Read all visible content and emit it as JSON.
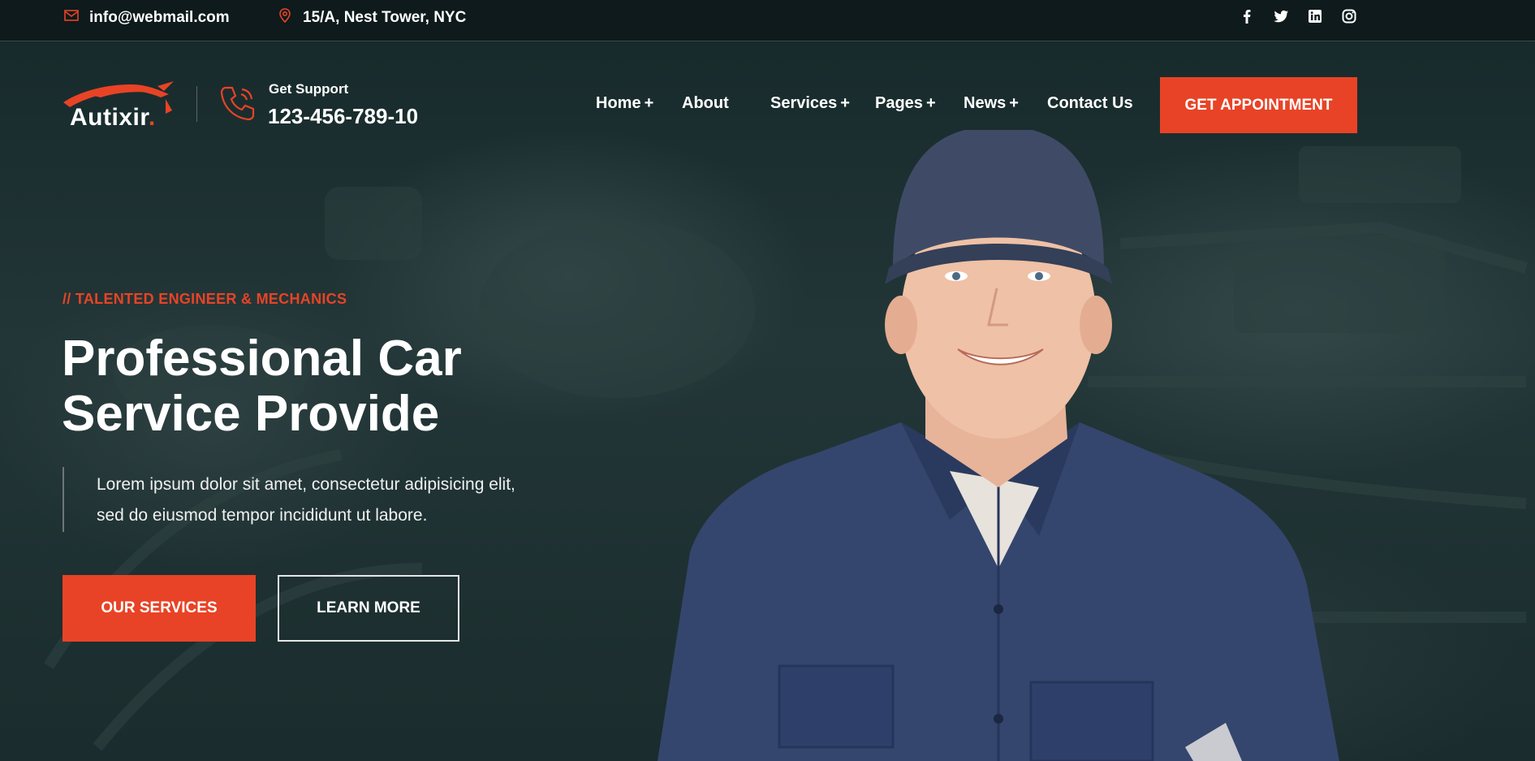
{
  "topbar": {
    "email": "info@webmail.com",
    "address": "15/A, Nest Tower, NYC",
    "social": [
      "facebook-icon",
      "twitter-icon",
      "linkedin-icon",
      "instagram-icon"
    ]
  },
  "brand": {
    "name": "Autixir",
    "dot": ".",
    "support_label": "Get Support",
    "support_phone": "123-456-789-10"
  },
  "nav": {
    "items": [
      {
        "label": "Home",
        "suffix": "+"
      },
      {
        "label": "About",
        "suffix": ""
      },
      {
        "label": "Services",
        "suffix": "+"
      },
      {
        "label": "Pages",
        "suffix": "+"
      },
      {
        "label": "News",
        "suffix": "+"
      },
      {
        "label": "Contact Us",
        "suffix": ""
      }
    ],
    "cta": "GET APPOINTMENT"
  },
  "hero": {
    "kicker": "// TALENTED ENGINEER & MECHANICS",
    "title_line1": "Professional Car",
    "title_line2": "Service Provide",
    "desc_line1": "Lorem ipsum dolor sit amet, consectetur adipisicing elit,",
    "desc_line2": "sed do eiusmod tempor incididunt ut labore.",
    "primary_button": "OUR SERVICES",
    "secondary_button": "LEARN MORE"
  },
  "colors": {
    "accent": "#e84326",
    "background": "#1a2c2d",
    "topbar": "#0e1a1b"
  }
}
